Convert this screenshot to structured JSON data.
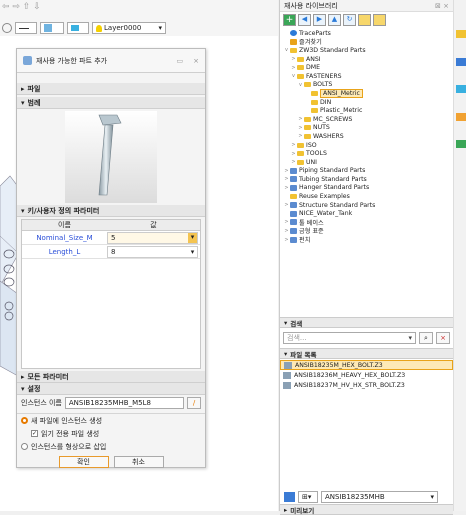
{
  "toolbar": {
    "layer": "Layer0000",
    "layer_chevron": "▾",
    "top_icons": "⇦ ⇨ ⇧ ⇩"
  },
  "library": {
    "title": "재사용 라이브러리",
    "close": "⊠ ⨯",
    "tree": [
      {
        "label": "TraceParts",
        "depth": 0,
        "icon": "globe",
        "tw": ""
      },
      {
        "label": "즐겨찾기",
        "depth": 0,
        "icon": "star",
        "tw": ""
      },
      {
        "label": "ZW3D Standard Parts",
        "depth": 0,
        "icon": "folder",
        "tw": "v"
      },
      {
        "label": "ANSI",
        "depth": 1,
        "icon": "folder",
        "tw": ">"
      },
      {
        "label": "DME",
        "depth": 1,
        "icon": "folder",
        "tw": ">"
      },
      {
        "label": "FASTENERS",
        "depth": 1,
        "icon": "folder",
        "tw": "v"
      },
      {
        "label": "BOLTS",
        "depth": 2,
        "icon": "folder",
        "tw": "v"
      },
      {
        "label": "ANSI_Metric",
        "depth": 3,
        "icon": "folder",
        "tw": "",
        "selected": true
      },
      {
        "label": "DIN",
        "depth": 3,
        "icon": "folder",
        "tw": ""
      },
      {
        "label": "Plastic_Metric",
        "depth": 3,
        "icon": "folder",
        "tw": ""
      },
      {
        "label": "MC_SCREWS",
        "depth": 2,
        "icon": "folder",
        "tw": ">"
      },
      {
        "label": "NUTS",
        "depth": 2,
        "icon": "folder",
        "tw": ">"
      },
      {
        "label": "WASHERS",
        "depth": 2,
        "icon": "folder",
        "tw": ">"
      },
      {
        "label": "ISO",
        "depth": 1,
        "icon": "folder",
        "tw": ">"
      },
      {
        "label": "TOOLS",
        "depth": 1,
        "icon": "folder",
        "tw": ">"
      },
      {
        "label": "UNI",
        "depth": 1,
        "icon": "folder",
        "tw": ">"
      },
      {
        "label": "Piping Standard Parts",
        "depth": 0,
        "icon": "part",
        "tw": ">"
      },
      {
        "label": "Tubing Standard Parts",
        "depth": 0,
        "icon": "part",
        "tw": ">"
      },
      {
        "label": "Hanger Standard Parts",
        "depth": 0,
        "icon": "part",
        "tw": ">"
      },
      {
        "label": "Reuse Examples",
        "depth": 0,
        "icon": "folder",
        "tw": ""
      },
      {
        "label": "Structure Standard Parts",
        "depth": 0,
        "icon": "part",
        "tw": ">"
      },
      {
        "label": "NICE_Water_Tank",
        "depth": 0,
        "icon": "part",
        "tw": ""
      },
      {
        "label": "툴 베이스",
        "depth": 0,
        "icon": "part",
        "tw": ">"
      },
      {
        "label": "금형 표준",
        "depth": 0,
        "icon": "part",
        "tw": ">"
      },
      {
        "label": "펀치",
        "depth": 0,
        "icon": "part",
        "tw": ">"
      }
    ],
    "search_section": "검색",
    "search_placeholder": "검색...",
    "search_chevron": "▾",
    "search_icon": "⌕",
    "file_section": "파일 목록",
    "files": [
      {
        "name": "ANSIB18235M_HEX_BOLT.Z3",
        "selected": true
      },
      {
        "name": "ANSIB18236M_HEAVY_HEX_BOLT.Z3",
        "selected": false
      },
      {
        "name": "ANSIB18237M_HV_HX_STR_BOLT.Z3",
        "selected": false
      }
    ],
    "bottom_filter": "ANSIB18235MHB",
    "bottom_chevron": "▾",
    "preview_section": "미리보기"
  },
  "dialog": {
    "title": "재사용 가능한 파트 추가",
    "min": "▭",
    "close": "⨯",
    "file_section": "파일",
    "range_section": "범례",
    "param_section": "키/사용자 정의 파라미터",
    "col_name": "이름",
    "col_value": "값",
    "params": [
      {
        "name": "Nominal_Size_M",
        "value": "5"
      },
      {
        "name": "Length_L",
        "value": "8"
      }
    ],
    "all_params": "모든 파라미터",
    "settings": "설정",
    "instance_label": "인스턴스 이름",
    "instance_value": "ANSIB18235MHB_M5L8",
    "opt1": "새 파일에 인스턴스 생성",
    "opt2": "읽기 전용 파일 생성",
    "opt3": "인스턴스를 형상으로 삽입",
    "ok": "확인",
    "cancel": "취소"
  }
}
